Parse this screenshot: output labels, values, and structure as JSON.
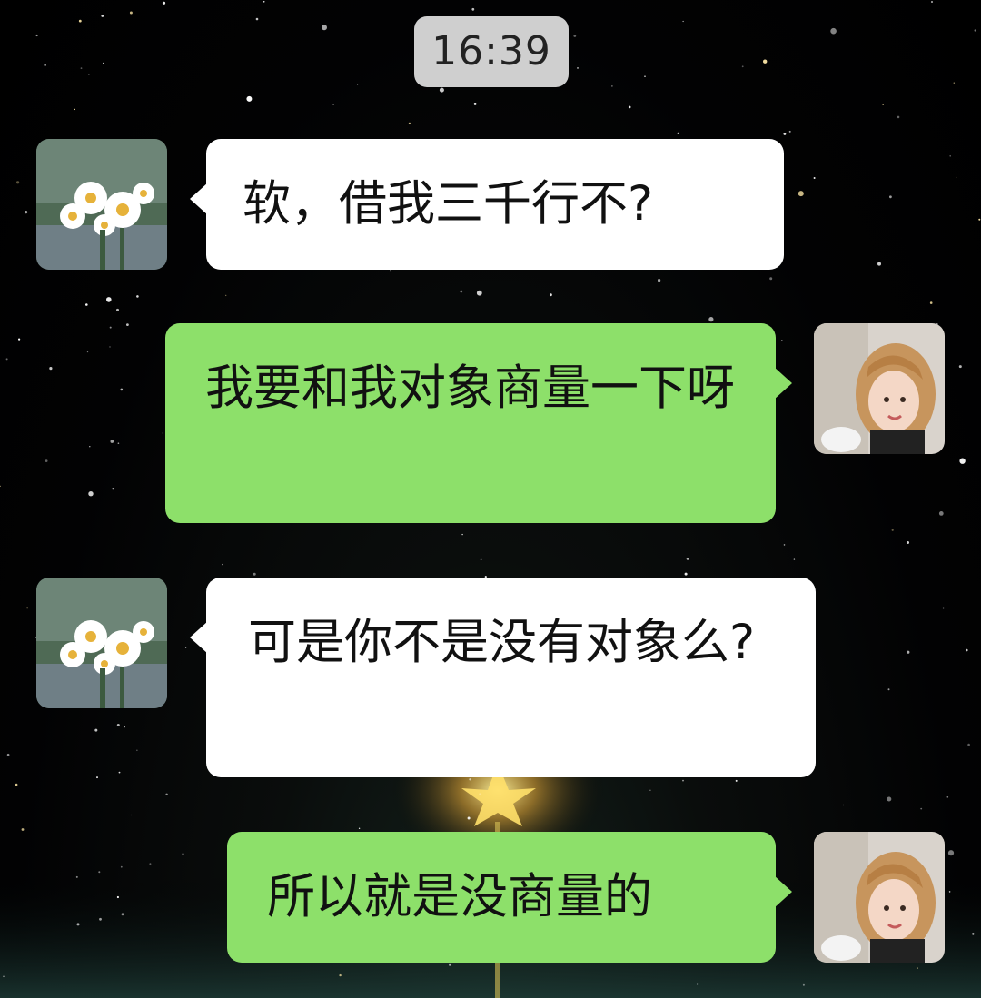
{
  "header": {
    "timestamp": "16:39"
  },
  "contacts": {
    "left": {
      "avatar_icon": "daisy-flowers-avatar"
    },
    "right": {
      "avatar_icon": "woman-portrait-avatar"
    }
  },
  "colors": {
    "incoming_bubble": "#ffffff",
    "outgoing_bubble": "#8de06a",
    "timestamp_pill": "#cfcfcf"
  },
  "messages": [
    {
      "side": "left",
      "text": "软，借我三千行不?"
    },
    {
      "side": "right",
      "text": "我要和我对象商量一下呀"
    },
    {
      "side": "left",
      "text": "可是你不是没有对象么?"
    },
    {
      "side": "right",
      "text": "所以就是没商量的"
    }
  ]
}
